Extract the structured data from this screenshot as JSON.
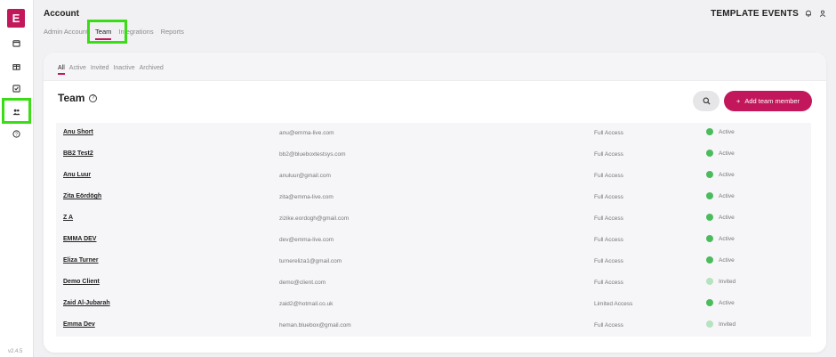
{
  "sidebar": {
    "logo_letter": "E",
    "items": [
      {
        "icon": "calendar-icon"
      },
      {
        "icon": "gift-icon"
      },
      {
        "icon": "checkbox-icon"
      },
      {
        "icon": "users-icon"
      },
      {
        "icon": "help-icon"
      }
    ],
    "version": "v2.4.5"
  },
  "header": {
    "title": "Account",
    "tabs": [
      {
        "label": "Admin Account"
      },
      {
        "label": "Team"
      },
      {
        "label": "Integrations"
      },
      {
        "label": "Reports"
      }
    ],
    "active_tab": "Team",
    "org_name": "TEMPLATE EVENTS"
  },
  "filters": [
    {
      "label": "All"
    },
    {
      "label": "Active"
    },
    {
      "label": "Invited"
    },
    {
      "label": "Inactive"
    },
    {
      "label": "Archived"
    }
  ],
  "section": {
    "title": "Team",
    "add_button_label": "Add team member",
    "add_button_plus": "+"
  },
  "members": [
    {
      "name": "Anu Short",
      "email": "anu@emma-live.com",
      "access": "Full Access",
      "status": "Active"
    },
    {
      "name": "BB2 Test2",
      "email": "bb2@blueboxtestsys.com",
      "access": "Full Access",
      "status": "Active"
    },
    {
      "name": "Anu Luur",
      "email": "anuluur@gmail.com",
      "access": "Full Access",
      "status": "Active"
    },
    {
      "name": "Zita Eördögh",
      "email": "zita@emma-live.com",
      "access": "Full Access",
      "status": "Active"
    },
    {
      "name": "Z A",
      "email": "zizike.eordogh@gmail.com",
      "access": "Full Access",
      "status": "Active"
    },
    {
      "name": "EMMA DEV",
      "email": "dev@emma-live.com",
      "access": "Full Access",
      "status": "Active"
    },
    {
      "name": "Eliza Turner",
      "email": "turnereliza1@gmail.com",
      "access": "Full Access",
      "status": "Active"
    },
    {
      "name": "Demo Client",
      "email": "demo@client.com",
      "access": "Full Access",
      "status": "Invited"
    },
    {
      "name": "Zaid Al-Jubarah",
      "email": "zaid2@hotmail.co.uk",
      "access": "Limited Access",
      "status": "Active"
    },
    {
      "name": "Emma Dev",
      "email": "heman.bluebox@gmail.com",
      "access": "Full Access",
      "status": "Invited"
    }
  ],
  "colors": {
    "brand": "#c2185b",
    "active_dot": "#4cbb5e",
    "invited_dot": "#b5e3bd",
    "highlight": "#3adc16"
  }
}
